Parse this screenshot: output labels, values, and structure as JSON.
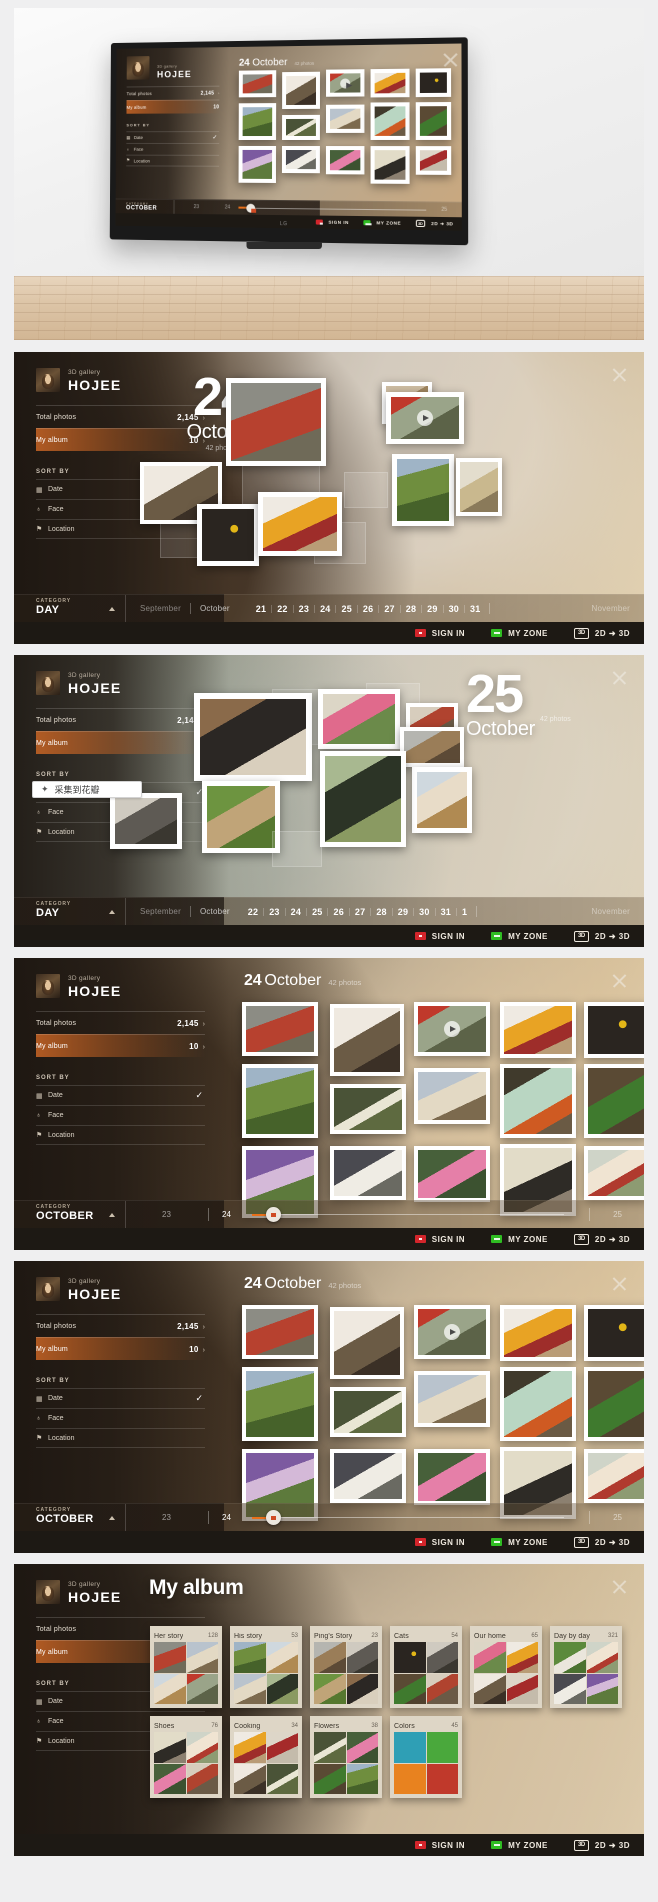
{
  "app": {
    "brand_sub": "3D gallery",
    "brand_name": "HOJEE",
    "stats": [
      {
        "label": "Total photos",
        "value": "2,145",
        "caret": "›"
      },
      {
        "label": "My album",
        "value": "10",
        "caret": "›"
      }
    ],
    "sort_by_title": "SORT BY",
    "sort_options": [
      {
        "icon": "calendar-icon",
        "glyph": "▦",
        "label": "Date",
        "selected": true,
        "check": "✓"
      },
      {
        "icon": "face-icon",
        "glyph": "♁",
        "label": "Face",
        "selected": false
      },
      {
        "icon": "location-pin-icon",
        "glyph": "⚑",
        "label": "Location",
        "selected": false
      }
    ],
    "close_label": "✕"
  },
  "footer": {
    "sign_in": "SIGN IN",
    "my_zone": "MY ZONE",
    "mode_3d_label": "3D",
    "mode_toggle": "2D ➜ 3D"
  },
  "panels": {
    "tv": {
      "title_number": "24",
      "title_month": "October",
      "photo_count": "42 photos",
      "tv_brand": "LG"
    },
    "day24": {
      "date_number": "24",
      "date_month": "October",
      "photo_count": "42 photos",
      "timeline": {
        "category_caption": "CATEGORY",
        "category_value": "DAY",
        "month_prev": "September",
        "month_current": "October",
        "days": [
          "21",
          "22",
          "23",
          "24",
          "25",
          "26",
          "27",
          "28",
          "29",
          "30",
          "31"
        ],
        "month_next": "November",
        "active_day": "24"
      }
    },
    "day25": {
      "date_number": "25",
      "date_month": "October",
      "photo_count": "42 photos",
      "timeline": {
        "category_caption": "CATEGORY",
        "category_value": "DAY",
        "month_prev": "September",
        "month_current": "October",
        "days": [
          "22",
          "23",
          "24",
          "25",
          "26",
          "27",
          "28",
          "29",
          "30",
          "31",
          "1"
        ],
        "month_next": "November",
        "active_day": "25"
      }
    },
    "grid24": {
      "title_number": "24",
      "title_month": "October",
      "photo_count": "42 photos",
      "timeline": {
        "category_caption": "CATEGORY",
        "category_value": "OCTOBER",
        "tick_left": "23",
        "tick_mid": "24",
        "tick_right": "25"
      }
    },
    "myalbum": {
      "title": "My album",
      "albums": [
        {
          "name": "Her story",
          "count": "128",
          "locked": false
        },
        {
          "name": "His story",
          "count": "53",
          "locked": true
        },
        {
          "name": "Ping's Story",
          "count": "23",
          "locked": false
        },
        {
          "name": "Cats",
          "count": "54",
          "locked": true
        },
        {
          "name": "Our home",
          "count": "65",
          "locked": false
        },
        {
          "name": "Day by day",
          "count": "321",
          "locked": false
        },
        {
          "name": "Shoes",
          "count": "76",
          "locked": false
        },
        {
          "name": "Cooking",
          "count": "34",
          "locked": false
        },
        {
          "name": "Flowers",
          "count": "38",
          "locked": false
        },
        {
          "name": "Colors",
          "count": "45",
          "locked": false
        }
      ]
    }
  },
  "overlay": {
    "collect_chip_icon": "✦",
    "collect_chip_label": "采集到花瓣"
  },
  "colors": {
    "accent_orange": "#d46a26",
    "sign_in_red": "#d3252b",
    "my_zone_green": "#2fbd22",
    "footer_bg": "#1d1914"
  }
}
